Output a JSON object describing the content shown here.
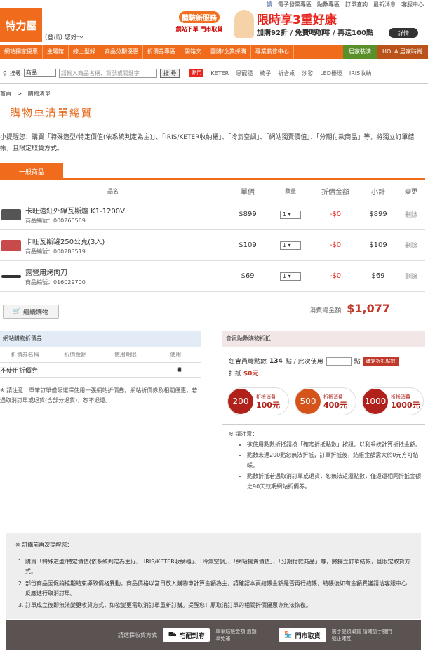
{
  "topbar": {
    "links": [
      "讀",
      "電子發票專區",
      "點數專區",
      "訂單查詢",
      "最新消息",
      "客服中心"
    ]
  },
  "header": {
    "logo": "特力屋",
    "hello": "(登出) 您好～"
  },
  "promo": {
    "tag1": "體驗新服務",
    "tag2": "網站下單 門市取貨",
    "big": "限時享3重好康",
    "sub": "加購92折 / 免費喝咖啡 / 再送100點",
    "detail": "詳情"
  },
  "nav": {
    "items": [
      "網站獨家優惠",
      "主題館",
      "線上型錄",
      "商品分期優惠",
      "折價券專區",
      "開箱文",
      "團購/企業採購",
      "專業裝修中心"
    ],
    "right1": "居家裝潢",
    "right2": "HOLA 居家時尚"
  },
  "search": {
    "label": "搜尋",
    "select": "商品",
    "placeholder": "請輸入商品名稱、貨號或關鍵字",
    "button": "搜 尋",
    "hot": "熱門",
    "keywords": [
      "KETER",
      "恩寵穩",
      "椅子",
      "折合桌",
      "沙發",
      "LED檯燈",
      "IRIS收納"
    ]
  },
  "crumb": {
    "home": "首頁",
    "sep": ">",
    "current": "購物清單"
  },
  "page_title": "購物車清單總覽",
  "notice": "小提醒您：購買「特殊造型/特定價值(依系統判定為主)」、「IRIS/KETER收納櫃」、「冷氣空調」、「網站獨賣價值」、「分期付款商品」等，將獨立訂單結帳，且限定取貨方式。",
  "tab": "一般商品",
  "cart": {
    "headers": [
      "品名",
      "單價",
      "數量",
      "折價金額",
      "小計",
      "變更"
    ],
    "items": [
      {
        "name": "卡旺遠紅外線瓦斯爐 K1-1200V",
        "sku": "商品編號：000260569",
        "price": "$899",
        "qty": "1",
        "discount": "-$0",
        "subtotal": "$899",
        "del": "刪除"
      },
      {
        "name": "卡旺瓦斯罐250公克(3入)",
        "sku": "商品編號：000283519",
        "price": "$109",
        "qty": "1",
        "discount": "-$0",
        "subtotal": "$109",
        "del": "刪除"
      },
      {
        "name": "露營用烤肉刀",
        "sku": "商品編號：016029700",
        "price": "$69",
        "qty": "1",
        "discount": "-$0",
        "subtotal": "$69",
        "del": "刪除"
      }
    ],
    "continue": "繼續購物",
    "total_label": "消費總金額",
    "total_value": "$1,077"
  },
  "coupon": {
    "title": "網站購物折價券",
    "cols": [
      "折價券名稱",
      "折價金額",
      "使用期限",
      "使用"
    ],
    "none": "不使用折價券",
    "note": "※ 請注意：單筆訂單僅限選擇使用一張網站折價券。網站折價券及相關優惠，若遇取消訂單或退貨(含部分退貨)，恕不退還。"
  },
  "points": {
    "title": "會員點數購物折抵",
    "have_pre": "您會員總點數",
    "have_val": "134",
    "have_post": "點 / 此次使用",
    "unit": "點",
    "confirm": "確定折抵點數",
    "deduct_label": "扣抵",
    "deduct_val": "$0元",
    "options": [
      {
        "pts": "200",
        "label": "折抵消費",
        "amount": "100元"
      },
      {
        "pts": "500",
        "label": "折抵消費",
        "amount": "400元"
      },
      {
        "pts": "1000",
        "label": "折抵消費",
        "amount": "1000元"
      }
    ],
    "note_title": "※ 請注意：",
    "notes": [
      "欲使用點數折抵請按「確定折抵點數」按鈕，以利系統計算折抵金額。",
      "點數未達200點恕無法折抵，訂單折抵後，結帳金額需大於0元方可結帳。",
      "點數折抵若遇取消訂單或退貨，恕無法返還點數，僅返還相同折抵金額之90天效期網站折價券。"
    ]
  },
  "reminder": {
    "title": "※ 訂購前再次提醒您：",
    "items": [
      "購買「特殊造型/特定價值(依系統判定為主)」、「IRIS/KETER收納櫃」、「冷氣空調」、「網站獨賣價值」、「分期付款商品」等，將獨立訂單結帳，且限定取貨方式。",
      "部份商品因促銷檔期結束導致價格異動，商品價格以當日放入購物車計算金額為主，請確認本頁結帳金額是否再行結帳，結帳後如有金額異議請洽客服中心反應進行取消訂單。",
      "訂單成立後即無法變更收貨方式，如欲變更需取消訂單重新訂購。提醒您！原取消訂單的相關折價優惠亦無法恢復。"
    ]
  },
  "footer": {
    "label": "請選擇收貨方式",
    "home": "宅配到府",
    "home_desc": "單筆結帳金額 過額享免運",
    "store": "門市取貨",
    "store_desc": "需手提領取貨 請確認手機門號正確性"
  }
}
